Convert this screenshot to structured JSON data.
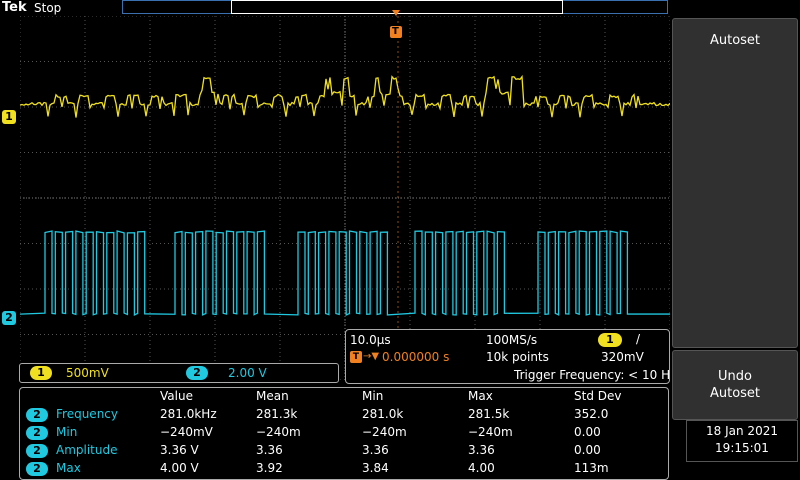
{
  "header": {
    "brand": "Tek",
    "run_state": "Stop",
    "trigger_marker": "T"
  },
  "channels": [
    {
      "label": "1",
      "color": "#f0e020"
    },
    {
      "label": "2",
      "color": "#20c8e0"
    }
  ],
  "vertical": {
    "ch1_scale": "500mV",
    "ch2_scale": "2.00 V"
  },
  "horizontal": {
    "time_div": "10.0μs",
    "sample_rate": "100MS/s",
    "trigger_source": "1",
    "trigger_slope": "/",
    "trigger_icon": "T",
    "position": "0.000000 s",
    "record_length": "10k points",
    "trigger_level": "320mV",
    "trigger_frequency": "Trigger Frequency: < 10 H"
  },
  "measurements": {
    "headers": [
      "Value",
      "Mean",
      "Min",
      "Max",
      "Std Dev"
    ],
    "rows": [
      {
        "ch": "2",
        "name": "Frequency",
        "value": "281.0kHz",
        "mean": "281.3k",
        "min": "281.0k",
        "max": "281.5k",
        "std": "352.0"
      },
      {
        "ch": "2",
        "name": "Min",
        "value": "−240mV",
        "mean": "−240m",
        "min": "−240m",
        "max": "−240m",
        "std": "0.00"
      },
      {
        "ch": "2",
        "name": "Amplitude",
        "value": "3.36 V",
        "mean": "3.36",
        "min": "3.36",
        "max": "3.36",
        "std": "0.00"
      },
      {
        "ch": "2",
        "name": "Max",
        "value": "4.00 V",
        "mean": "3.92",
        "min": "3.84",
        "max": "4.00",
        "std": "113m"
      }
    ]
  },
  "side_menu": {
    "autoset_label": "Autoset",
    "undo_label_line1": "Undo",
    "undo_label_line2": "Autoset"
  },
  "clock": {
    "date": "18 Jan  2021",
    "time": "19:15:01"
  },
  "colors": {
    "ch1": "#f0e020",
    "ch2": "#20c8e0",
    "trigger": "#f08020",
    "grid": "#808080"
  }
}
